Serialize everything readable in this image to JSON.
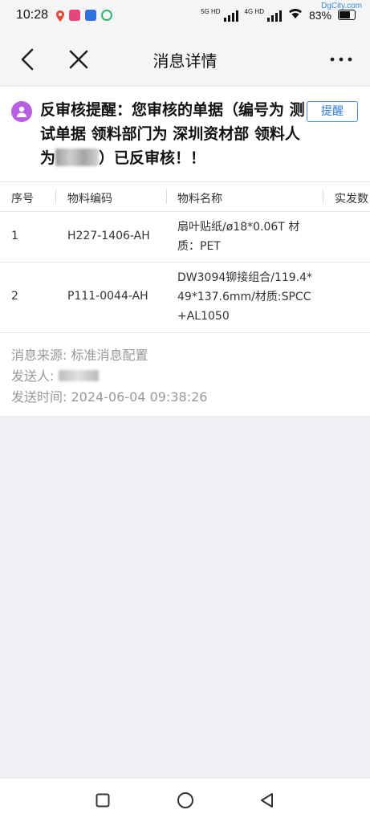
{
  "status_bar": {
    "time": "10:28",
    "signal1_label": "5G HD",
    "signal2_label": "4G HD",
    "battery": "83%",
    "watermark": "DgCity.com"
  },
  "nav": {
    "title": "消息详情"
  },
  "message": {
    "title_part1": "反审核提醒：您审核的单据（编号为 测试单据 领料部门为 深圳资材部 领料人为",
    "title_part2": "）已反审核！！",
    "remind_label": "提醒"
  },
  "table": {
    "headers": [
      "序号",
      "物料编码",
      "物料名称",
      "实发数"
    ],
    "rows": [
      {
        "index": "1",
        "code": "H227-1406-AH",
        "name": "扇叶贴纸/ø18*0.06T 材质：PET"
      },
      {
        "index": "2",
        "code": "P111-0044-AH",
        "name": "DW3094铆接组合/119.4*49*137.6mm/材质:SPCC+AL1050"
      }
    ]
  },
  "meta": {
    "source_label": "消息来源:",
    "source_value": "标准消息配置",
    "sender_label": "发送人:",
    "time_label": "发送时间:",
    "time_value": "2024-06-04 09:38:26"
  },
  "colors": {
    "accent": "#2e7bd6",
    "avatar": "#b85ee0",
    "background": "#efeff4"
  }
}
